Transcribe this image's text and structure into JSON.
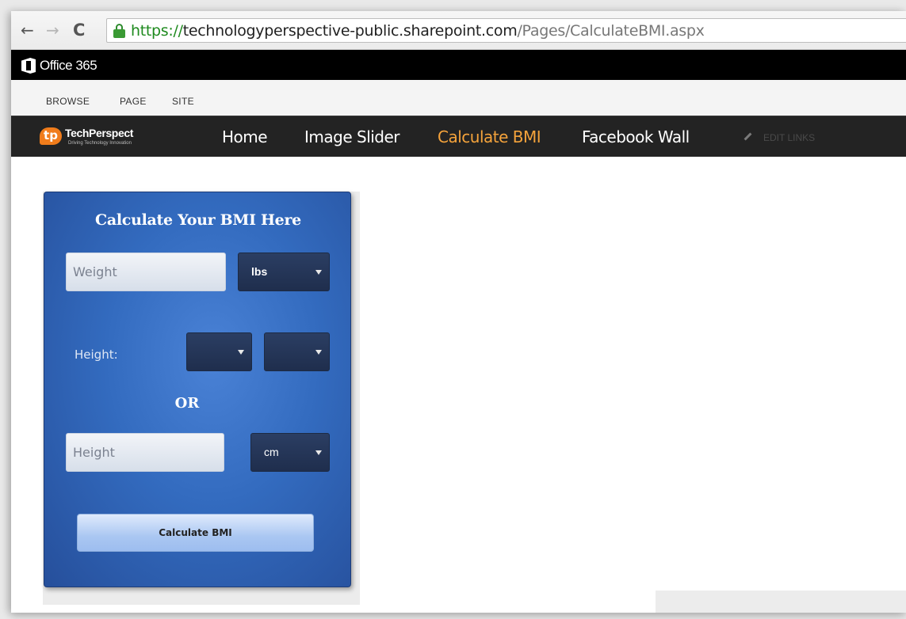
{
  "browser": {
    "url_scheme": "https://",
    "url_host": "technologyperspective-public.sharepoint.com",
    "url_path": "/Pages/CalculateBMI.aspx",
    "back_glyph": "←",
    "forward_glyph": "→",
    "reload_glyph": "C"
  },
  "suite_bar": {
    "label": "Office 365"
  },
  "ribbon": {
    "tabs": [
      "BROWSE",
      "PAGE",
      "SITE"
    ]
  },
  "site": {
    "logo_mark": "tp",
    "logo_name": "TechPerspect",
    "logo_tagline": "Driving Technology Innovation",
    "nav": [
      "Home",
      "Image Slider",
      "Calculate BMI",
      "Facebook Wall"
    ],
    "active_nav": "Calculate BMI",
    "edit_links": "EDIT LINKS"
  },
  "bmi_form": {
    "title": "Calculate Your BMI Here",
    "weight_placeholder": "Weight",
    "weight_unit": "lbs",
    "height_label": "Height:",
    "height_feet": "",
    "height_inches": "",
    "or_label": "OR",
    "height_placeholder": "Height",
    "height_unit": "cm",
    "button_label": "Calculate BMI"
  },
  "colors": {
    "accent_nav": "#f5a33b",
    "card_blue": "#336bbf",
    "select_navy": "#24355a",
    "url_green": "#1e8a1e"
  }
}
